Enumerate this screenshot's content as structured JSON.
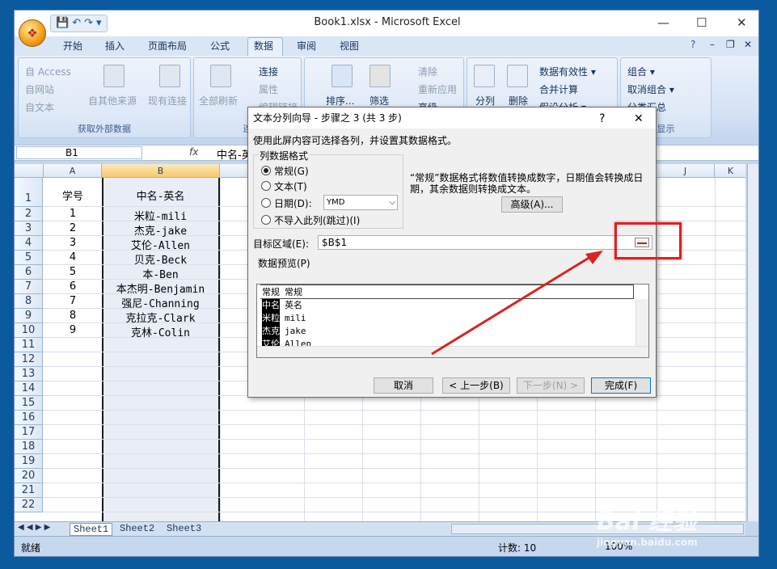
{
  "window": {
    "title": "Book1.xlsx - Microsoft Excel"
  },
  "office_button": {
    "glyph": "❖"
  },
  "qat": {
    "save": "💾",
    "undo": "↶",
    "redo": "↷",
    "more": "▾"
  },
  "controls": {
    "minimize": "—",
    "maximize": "☐",
    "close": "✕",
    "help": "?",
    "doc_min": "–",
    "doc_restore": "❐",
    "doc_close": "✕"
  },
  "tabs": [
    "开始",
    "插入",
    "页面布局",
    "公式",
    "数据",
    "审阅",
    "视图"
  ],
  "ribbon": {
    "get_external": {
      "items": [
        "自 Access",
        "自网站",
        "自文本"
      ],
      "other": "自其他来源",
      "existing": "现有连接",
      "group": "获取外部数据"
    },
    "connections": {
      "refresh": "全部刷新",
      "conn": "连接",
      "props": "属性",
      "edit": "编辑链接",
      "group": "连"
    },
    "sort": {
      "sort": "排序...",
      "filter": "筛选",
      "clear": "清除",
      "reapply": "重新应用",
      "advanced": "高级"
    },
    "tools": {
      "split": "分列",
      "delete": "删除",
      "validation": "数据有效性 ▾",
      "consolidate": "合并计算",
      "whatif": "假设分析 ▾"
    },
    "outline": {
      "group_btn": "组合 ▾",
      "ungroup": "取消组合 ▾",
      "subtotal": "分类汇总",
      "group": "显示"
    }
  },
  "formula_bar": {
    "name_box": "B1",
    "fx": "fx",
    "value": "中名-英"
  },
  "columns": [
    "A",
    "B",
    "J",
    "K"
  ],
  "rows": [
    "1",
    "2",
    "3",
    "4",
    "5",
    "6",
    "7",
    "8",
    "9",
    "10",
    "11",
    "12",
    "13",
    "14",
    "15",
    "16",
    "17",
    "18",
    "19",
    "20",
    "21",
    "22"
  ],
  "cells": {
    "A": [
      "学号",
      "1",
      "2",
      "3",
      "4",
      "5",
      "6",
      "7",
      "8",
      "9"
    ],
    "B": [
      "中名-英名",
      "米粒-mili",
      "杰克-jake",
      "艾伦-Allen",
      "贝克-Beck",
      "本-Ben",
      "本杰明-Benjamin",
      "强尼-Channing",
      "克拉克-Clark",
      "克林-Colin"
    ]
  },
  "sheets": [
    "Sheet1",
    "Sheet2",
    "Sheet3"
  ],
  "status": {
    "mode": "就绪",
    "count": "计数: 10",
    "zoom": "100%"
  },
  "dialog": {
    "title": "文本分列向导 - 步骤之 3 (共 3 步)",
    "help": "?",
    "close": "✕",
    "instruction": "使用此屏内容可选择各列，并设置其数据格式。",
    "format_group": "列数据格式",
    "options": [
      "常规(G)",
      "文本(T)",
      "日期(D):",
      "不导入此列(跳过)(I)"
    ],
    "date_format": "YMD",
    "description": "“常规”数据格式将数值转换成数字，日期值会转换成日期，其余数据则转换成文本。",
    "advanced": "高级(A)...",
    "dest_label": "目标区域(E):",
    "dest_value": "$B$1",
    "preview_label": "数据预览(P)",
    "preview_headers": [
      "常规",
      "常规"
    ],
    "preview_rows": [
      [
        "中名",
        "英名"
      ],
      [
        "米粒",
        "mili"
      ],
      [
        "杰克",
        "jake"
      ],
      [
        "艾伦",
        "Allen"
      ]
    ],
    "buttons": {
      "cancel": "取消",
      "back": "< 上一步(B)",
      "next": "下一步(N) >",
      "finish": "完成(F)"
    }
  },
  "watermark": "Bai 经验",
  "watermark_sub": "jingyan.baidu.com"
}
